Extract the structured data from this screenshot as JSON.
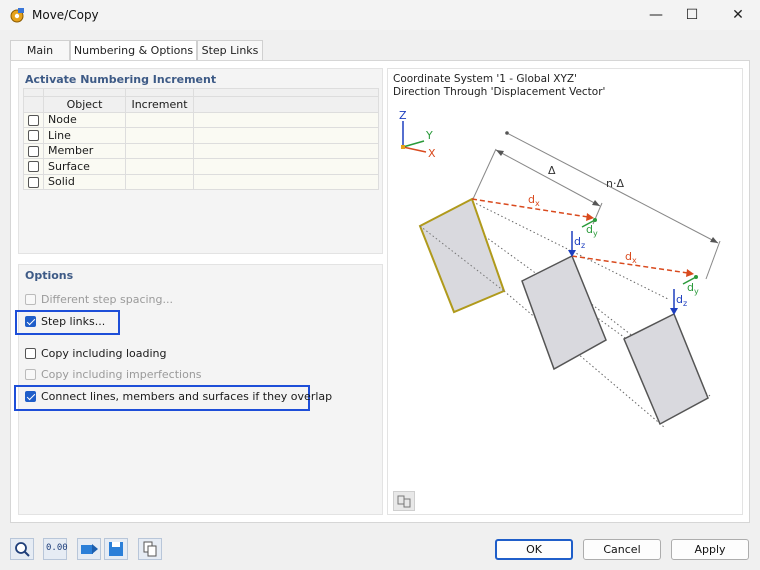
{
  "window": {
    "title": "Move/Copy",
    "minimize": "—",
    "maximize": "☐",
    "close": "✕"
  },
  "tabs": [
    {
      "label": "Main"
    },
    {
      "label": "Numbering & Options"
    },
    {
      "label": "Step Links"
    }
  ],
  "numbering": {
    "title": "Activate Numbering Increment",
    "columns": [
      "Object",
      "Increment"
    ],
    "rows": [
      {
        "object": "Node",
        "increment": "",
        "checked": false
      },
      {
        "object": "Line",
        "increment": "",
        "checked": false
      },
      {
        "object": "Member",
        "increment": "",
        "checked": false
      },
      {
        "object": "Surface",
        "increment": "",
        "checked": false
      },
      {
        "object": "Solid",
        "increment": "",
        "checked": false
      }
    ]
  },
  "options": {
    "title": "Options",
    "items": [
      {
        "label": "Different step spacing...",
        "checked": false,
        "disabled": true
      },
      {
        "label": "Step links...",
        "checked": true,
        "disabled": false,
        "highlighted": true
      },
      {
        "label": "Copy including loading",
        "checked": false,
        "disabled": false
      },
      {
        "label": "Copy including imperfections",
        "checked": false,
        "disabled": true
      },
      {
        "label": "Connect lines, members and surfaces if they overlap",
        "checked": true,
        "disabled": false,
        "highlighted": true
      }
    ]
  },
  "preview": {
    "line1": "Coordinate System '1 - Global XYZ'",
    "line2": "Direction Through 'Displacement Vector'",
    "axis_z": "Z",
    "axis_y": "Y",
    "axis_x": "X",
    "delta": "Δ",
    "n_delta": "n·Δ",
    "dx": "d",
    "dx_sub": "x",
    "dy": "d",
    "dy_sub": "y",
    "dz": "d",
    "dz_sub": "z"
  },
  "footer": {
    "ok": "OK",
    "cancel": "Cancel",
    "apply": "Apply",
    "units_tool": "0.00"
  },
  "colors": {
    "accent": "#1f5ec9",
    "highlight": "#1d4ed8",
    "group_title": "#3d5a86",
    "original_edge": "#b09a1c",
    "dx_color": "#d94a1e",
    "dy_color": "#2a9a3a",
    "dz_color": "#1e3fbf"
  }
}
